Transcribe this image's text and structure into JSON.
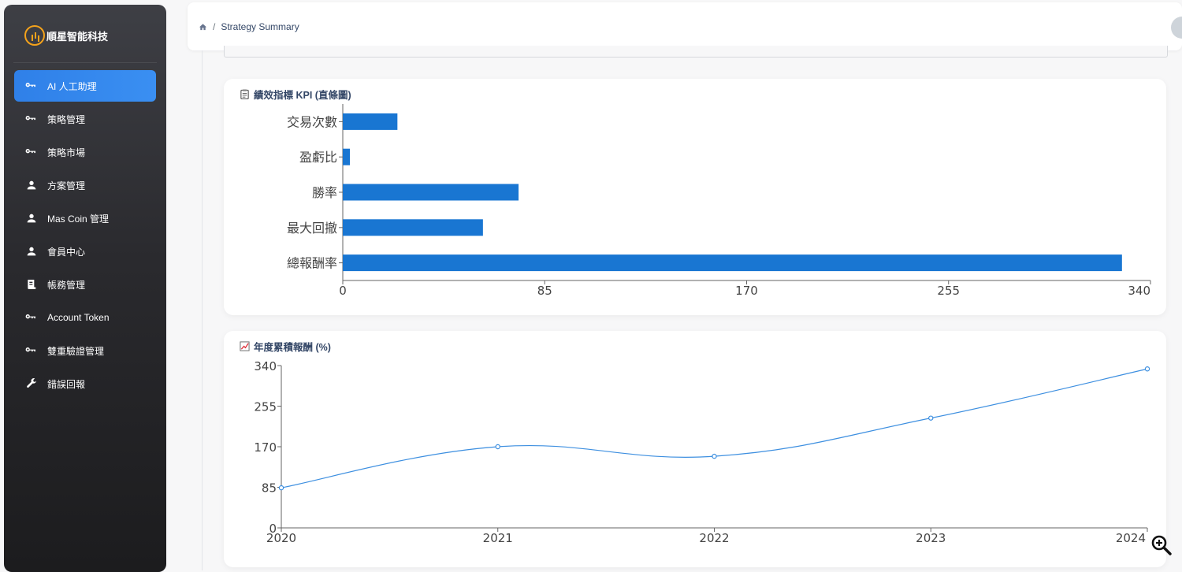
{
  "brand": {
    "name": "順星智能科技"
  },
  "sidebar": {
    "items": [
      {
        "label": "AI 人工助理",
        "icon": "key-icon",
        "active": true
      },
      {
        "label": "策略管理",
        "icon": "key-icon"
      },
      {
        "label": "策略市場",
        "icon": "key-icon"
      },
      {
        "label": "方案管理",
        "icon": "person-icon"
      },
      {
        "label": "Mas Coin 管理",
        "icon": "person-icon"
      },
      {
        "label": "會員中心",
        "icon": "person-icon"
      },
      {
        "label": "帳務管理",
        "icon": "receipt-icon"
      },
      {
        "label": "Account Token",
        "icon": "key-icon"
      },
      {
        "label": "雙重驗證管理",
        "icon": "key-icon"
      },
      {
        "label": "錯誤回報",
        "icon": "wrench-icon"
      }
    ]
  },
  "header": {
    "breadcrumb_home_icon": "home-icon",
    "breadcrumb_sep": "/",
    "breadcrumb_current": "Strategy Summary"
  },
  "kpi_card": {
    "title": "績效指標 KPI (直條圖)"
  },
  "return_card": {
    "title": "年度累積報酬 (%)"
  },
  "colors": {
    "accent": "#2f80e8",
    "bar": "#1976d2",
    "line": "#3d8fe0"
  },
  "chart_data": [
    {
      "type": "bar",
      "orientation": "horizontal",
      "categories": [
        "交易次數",
        "盈虧比",
        "勝率",
        "最大回撤",
        "總報酬率"
      ],
      "values": [
        23,
        3,
        74,
        59,
        328
      ],
      "xlim": [
        0,
        340
      ],
      "xticks": [
        "0",
        "85",
        "170",
        "255",
        "340"
      ]
    },
    {
      "type": "line",
      "x": [
        "2020",
        "2021",
        "2022",
        "2023",
        "2024"
      ],
      "values": [
        84,
        170,
        150,
        230,
        333
      ],
      "ylim": [
        0,
        340
      ],
      "yticks": [
        "0",
        "85",
        "170",
        "255",
        "340"
      ],
      "smooth": true
    }
  ]
}
